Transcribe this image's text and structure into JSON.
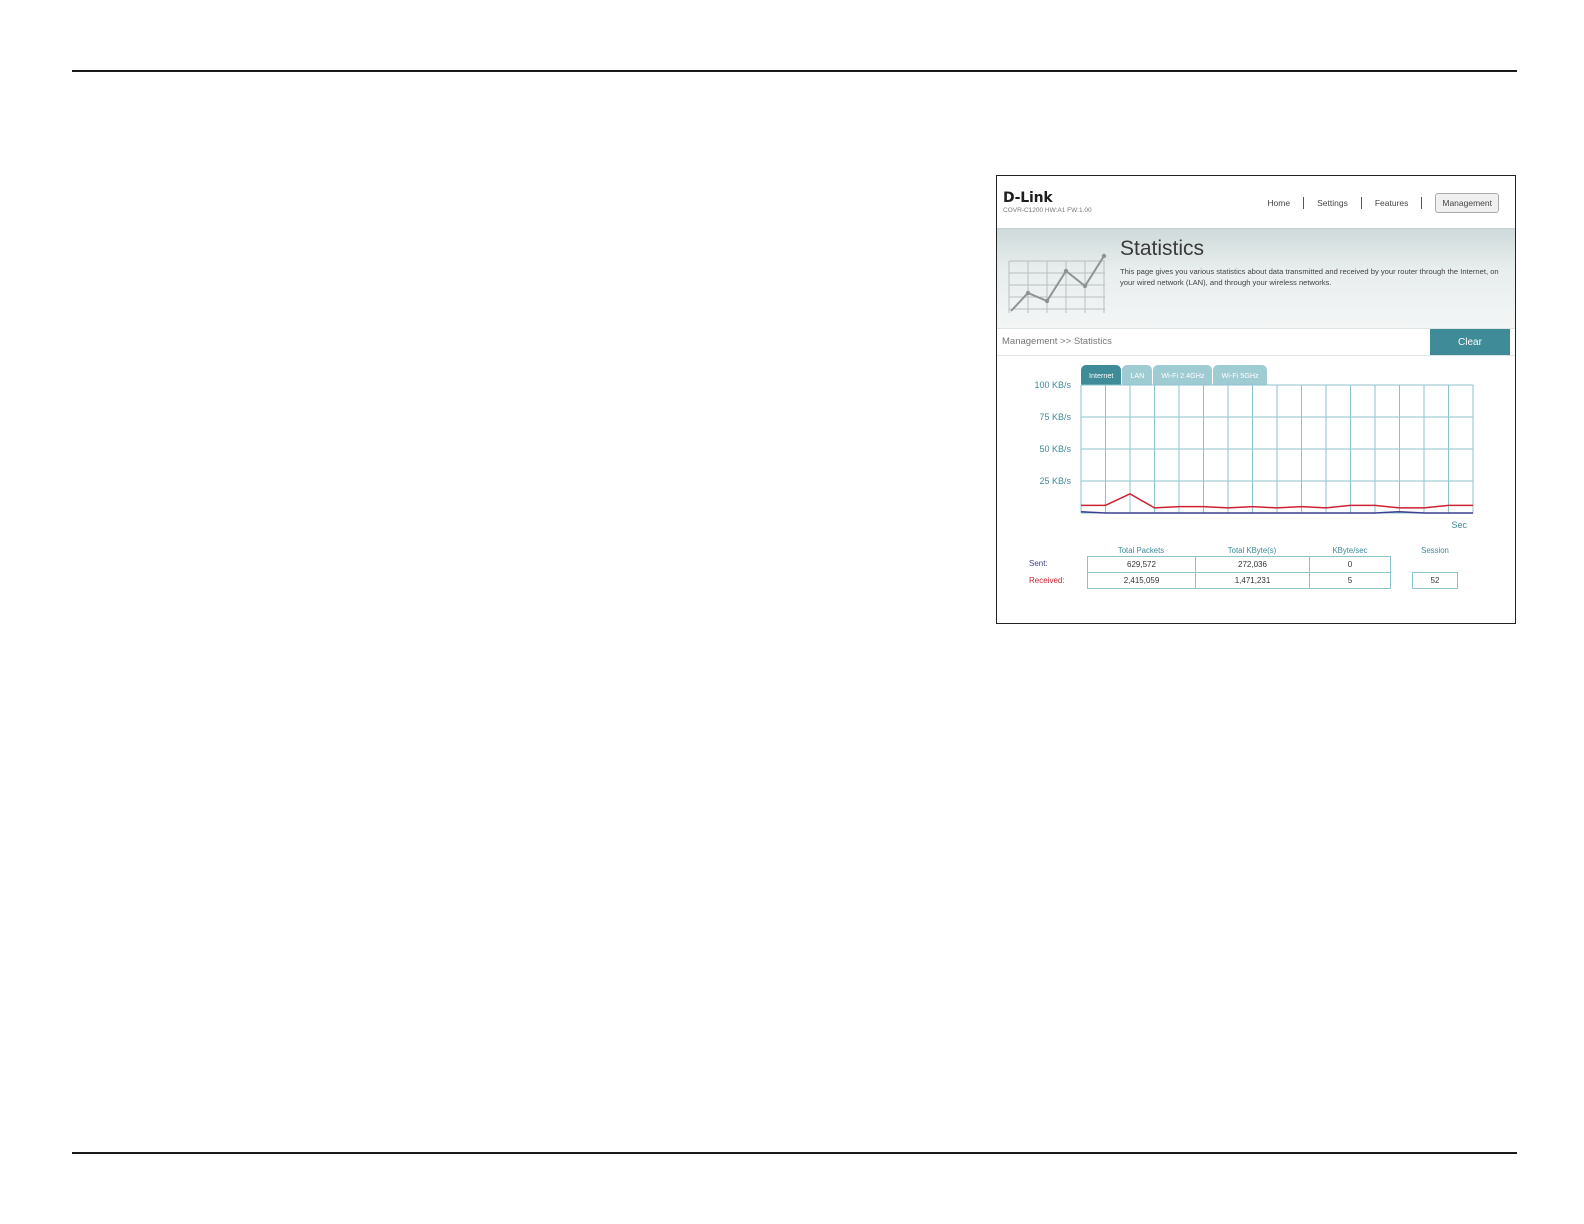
{
  "router_ui": {
    "brand": "D-Link",
    "model_info": "COVR-C1200 HW:A1 FW:1.00",
    "nav": [
      {
        "label": "Home"
      },
      {
        "label": "Settings"
      },
      {
        "label": "Features"
      },
      {
        "label": "Management",
        "active": true
      }
    ],
    "page_title": "Statistics",
    "page_description": "This page gives you various statistics about data transmitted and received by your router through the Internet, on your wired network (LAN), and through your wireless networks.",
    "breadcrumb": "Management >> Statistics",
    "clear_label": "Clear",
    "tabs": [
      {
        "label": "Internet",
        "active": true
      },
      {
        "label": "LAN"
      },
      {
        "label": "Wi-Fi 2.4GHz"
      },
      {
        "label": "Wi-Fi 5GHz"
      }
    ],
    "table": {
      "headers": [
        "Total Packets",
        "Total KByte(s)",
        "KByte/sec"
      ],
      "session_label": "Session",
      "rows": [
        {
          "label": "Sent:",
          "color": "#3b3f8f",
          "values": [
            "629,572",
            "272,036",
            "0"
          ]
        },
        {
          "label": "Received:",
          "color": "#cc2233",
          "values": [
            "2,415,059",
            "1,471,231",
            "5"
          ]
        }
      ],
      "session_value": "52"
    }
  },
  "chart_data": {
    "type": "line",
    "y_tick_labels": [
      "100 KB/s",
      "75 KB/s",
      "50 KB/s",
      "25 KB/s"
    ],
    "xlabel": "Sec",
    "ylim": [
      0,
      100
    ],
    "grid": true,
    "x": [
      0,
      1,
      2,
      3,
      4,
      5,
      6,
      7,
      8,
      9,
      10,
      11,
      12,
      13,
      14,
      15,
      16
    ],
    "series": [
      {
        "name": "Received",
        "color": "#cc2233",
        "values": [
          6,
          6,
          15,
          4,
          5,
          5,
          4,
          5,
          4,
          5,
          4,
          6,
          6,
          4,
          4,
          6,
          6
        ]
      },
      {
        "name": "Sent",
        "color": "#3b3f8f",
        "values": [
          1,
          0,
          0,
          0,
          0,
          0,
          0,
          0,
          0,
          0,
          0,
          0,
          0,
          1,
          0,
          0,
          0
        ]
      }
    ]
  }
}
